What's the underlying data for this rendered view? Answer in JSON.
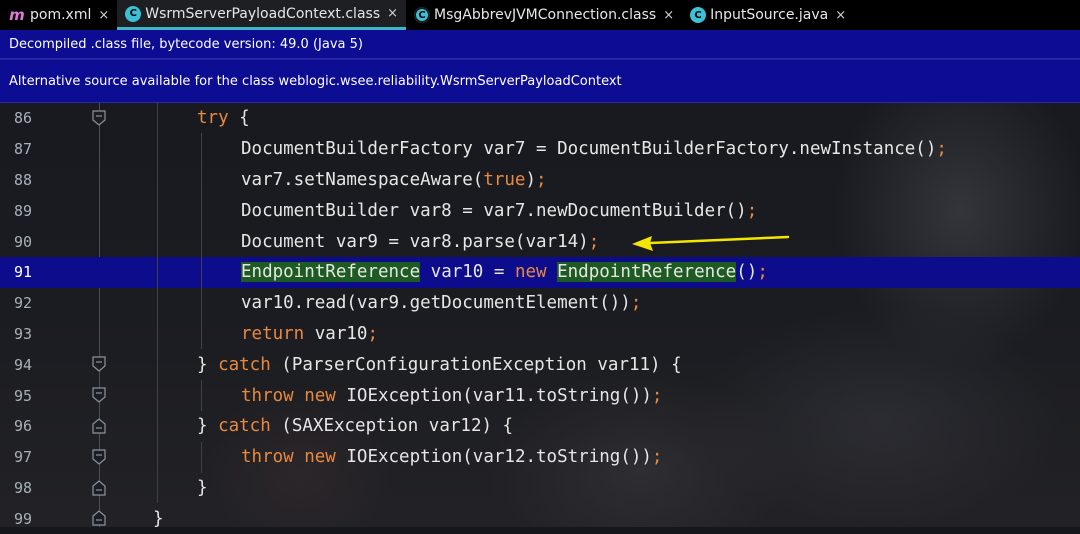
{
  "tabs": [
    {
      "label": "pom.xml",
      "icon": "maven-icon",
      "active": false
    },
    {
      "label": "WsrmServerPayloadContext.class",
      "icon": "class-icon",
      "active": true
    },
    {
      "label": "MsgAbbrevJVMConnection.class",
      "icon": "class-icon",
      "active": false
    },
    {
      "label": "InputSource.java",
      "icon": "class-icon",
      "active": false
    }
  ],
  "close_glyph": "×",
  "banner": {
    "decompiled": "Decompiled .class file, bytecode version: 49.0 (Java 5)",
    "alternative": "Alternative source available for the class weblogic.wsee.reliability.WsrmServerPayloadContext"
  },
  "current_line": "91",
  "lines": [
    {
      "num": "86",
      "tokens": [
        "try",
        " {"
      ]
    },
    {
      "num": "87",
      "tokens": [
        "DocumentBuilderFactory var7 = DocumentBuilderFactory.newInstance()",
        ";"
      ]
    },
    {
      "num": "88",
      "tokens": [
        "var7.setNamespaceAware(",
        "true",
        ")",
        ";"
      ]
    },
    {
      "num": "89",
      "tokens": [
        "DocumentBuilder var8 = var7.newDocumentBuilder()",
        ";"
      ]
    },
    {
      "num": "90",
      "tokens": [
        "Document var9 = var8.parse(var14)",
        ";"
      ]
    },
    {
      "num": "91",
      "tokens": [
        "EndpointReference",
        " var10 = ",
        "new",
        " ",
        "EndpointReference",
        "()",
        ";"
      ]
    },
    {
      "num": "92",
      "tokens": [
        "var10.read(var9.getDocumentElement())",
        ";"
      ]
    },
    {
      "num": "93",
      "tokens": [
        "return",
        " var10",
        ";"
      ]
    },
    {
      "num": "94",
      "tokens": [
        "} ",
        "catch",
        " (ParserConfigurationException var11) {"
      ]
    },
    {
      "num": "95",
      "tokens": [
        "throw",
        " ",
        "new",
        " IOException(var11.toString())",
        ";"
      ]
    },
    {
      "num": "96",
      "tokens": [
        "} ",
        "catch",
        " (SAXException var12) {"
      ]
    },
    {
      "num": "97",
      "tokens": [
        "throw",
        " ",
        "new",
        " IOException(var12.toString())",
        ";"
      ]
    },
    {
      "num": "98",
      "tokens": [
        "}"
      ]
    },
    {
      "num": "99",
      "tokens": [
        "}"
      ]
    }
  ],
  "colors": {
    "keyword": "#e8893f",
    "current_line_bg": "#0c0c8c",
    "banner_bg": "#0d0d93",
    "class_highlight": "#1e5b22",
    "arrow": "#f5e600"
  }
}
